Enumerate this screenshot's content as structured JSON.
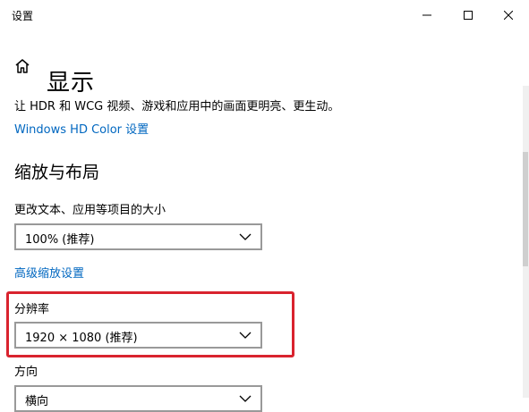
{
  "window": {
    "title": "设置",
    "colors": {
      "accent_link": "#0067c0",
      "highlight": "#d9232e"
    }
  },
  "header": {
    "title": "显示",
    "home_icon": "home-icon"
  },
  "hdr": {
    "description": "让 HDR 和 WCG 视频、游戏和应用中的画面更明亮、更生动。",
    "link": "Windows HD Color 设置"
  },
  "scale_layout": {
    "section_title": "缩放与布局",
    "text_size_label": "更改文本、应用等项目的大小",
    "scale_value": "100% (推荐)",
    "advanced_link": "高级缩放设置",
    "resolution_label": "分辨率",
    "resolution_value": "1920 × 1080 (推荐)",
    "orientation_label": "方向",
    "orientation_value": "横向"
  }
}
